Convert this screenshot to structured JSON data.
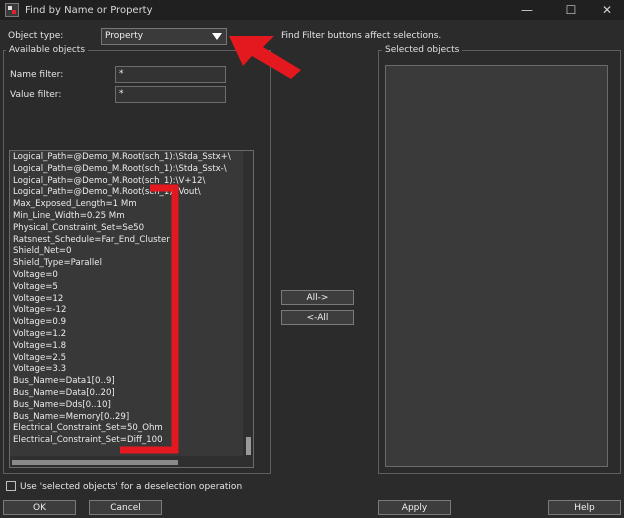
{
  "window": {
    "title": "Find by Name or Property",
    "minimize_glyph": "—",
    "maximize_glyph": "☐",
    "close_glyph": "✕"
  },
  "object_type": {
    "label": "Object type:",
    "value": "Property"
  },
  "info_text": "Find Filter buttons affect selections.",
  "available": {
    "group_label": "Available objects",
    "name_filter_label": "Name filter:",
    "name_filter_value": "*",
    "value_filter_label": "Value filter:",
    "value_filter_value": "*",
    "items": [
      "Logical_Path=@Demo_M.Root(sch_1):\\Stda_Sstx+\\",
      "Logical_Path=@Demo_M.Root(sch_1):\\Stda_Sstx-\\",
      "Logical_Path=@Demo_M.Root(sch_1):\\V+12\\",
      "Logical_Path=@Demo_M.Root(sch_1):\\Vout\\",
      "Max_Exposed_Length=1 Mm",
      "Min_Line_Width=0.25 Mm",
      "Physical_Constraint_Set=Se50",
      "Ratsnest_Schedule=Far_End_Cluster",
      "Shield_Net=0",
      "Shield_Type=Parallel",
      "Voltage=0",
      "Voltage=5",
      "Voltage=12",
      "Voltage=-12",
      "Voltage=0.9",
      "Voltage=1.2",
      "Voltage=1.8",
      "Voltage=2.5",
      "Voltage=3.3",
      "Bus_Name=Data1[0..9]",
      "Bus_Name=Data[0..20]",
      "Bus_Name=Dds[0..10]",
      "Bus_Name=Memory[0..29]",
      "Electrical_Constraint_Set=50_Ohm",
      "Electrical_Constraint_Set=Diff_100"
    ]
  },
  "selected": {
    "group_label": "Selected objects"
  },
  "middle_buttons": {
    "all_right": "All->",
    "all_left": "<-All"
  },
  "deselect_option": {
    "label": "Use 'selected objects' for a deselection operation",
    "checked": false
  },
  "bottom_buttons": {
    "ok": "OK",
    "cancel": "Cancel",
    "apply": "Apply",
    "help": "Help"
  },
  "colors": {
    "annotation_red": "#e3191f",
    "background": "#2b2b2b"
  }
}
